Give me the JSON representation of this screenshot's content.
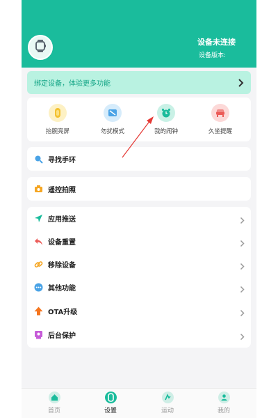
{
  "header": {
    "device_status": "设备未连接",
    "device_version": "设备版本:",
    "avatar_icon": "watch-icon"
  },
  "bind_banner": {
    "text": "绑定设备，体验更多功能",
    "icon": "chevron-right-icon"
  },
  "quick_actions": [
    {
      "label": "抬腕亮屏",
      "icon": "raise-wrist-icon",
      "color": "#f3c12f"
    },
    {
      "label": "勿扰模式",
      "icon": "do-not-disturb-icon",
      "color": "#4aa3e6"
    },
    {
      "label": "我的闹钟",
      "icon": "alarm-clock-icon",
      "color": "#1abc9c"
    },
    {
      "label": "久坐提醒",
      "icon": "sedentary-reminder-icon",
      "color": "#ec5b58"
    }
  ],
  "find_band": {
    "label": "寻找手环",
    "icon": "search-icon"
  },
  "remote_camera": {
    "label": "遥控拍照",
    "icon": "camera-icon"
  },
  "settings_list": [
    {
      "label": "应用推送",
      "icon": "send-icon",
      "color": "#1abc9c"
    },
    {
      "label": "设备重置",
      "icon": "reset-icon",
      "color": "#ec5b58"
    },
    {
      "label": "移除设备",
      "icon": "link-icon",
      "color": "#f5a623"
    },
    {
      "label": "其他功能",
      "icon": "more-icon",
      "color": "#4aa3e6"
    },
    {
      "label": "OTA升级",
      "icon": "upgrade-icon",
      "color": "#f5751e"
    },
    {
      "label": "后台保护",
      "icon": "protect-icon",
      "color": "#c65bd8"
    }
  ],
  "tabbar": [
    {
      "label": "首页",
      "icon": "home-icon",
      "active": false
    },
    {
      "label": "设置",
      "icon": "settings-icon",
      "active": true
    },
    {
      "label": "运动",
      "icon": "sport-icon",
      "active": false
    },
    {
      "label": "我的",
      "icon": "profile-icon",
      "active": false
    }
  ],
  "colors": {
    "accent": "#1abc9c",
    "banner_bg": "#b9f2e1",
    "arrow": "#e53935"
  }
}
